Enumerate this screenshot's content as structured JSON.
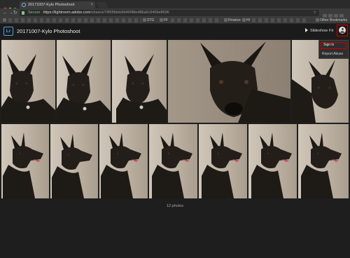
{
  "browser": {
    "tab_title": "20171007-Kylo Photoshoot",
    "url_secure_label": "Secure",
    "url_host": "https://lightroom.adobe.com",
    "url_path": "/shares/74f05fdeb9d46f48e486a5c9469e8696"
  },
  "bookmarks": [
    {
      "label": "STG"
    },
    {
      "label": "FF"
    },
    {
      "label": "Finance"
    },
    {
      "label": "HI"
    }
  ],
  "bookmarks_other": "Other Bookmarks",
  "app": {
    "logo": "Lr",
    "album_title": "20171007-Kylo Photoshoot",
    "slideshow_label": "Slideshow",
    "fit_label": "Fit"
  },
  "menu": {
    "sign_in": "Sign in",
    "report_abuse": "Report Abuse"
  },
  "photos": {
    "count_caption": "12 photos"
  },
  "colors": {
    "highlight": "#cc0000",
    "accent": "#4fa3e0",
    "secure": "#7ec77e"
  }
}
